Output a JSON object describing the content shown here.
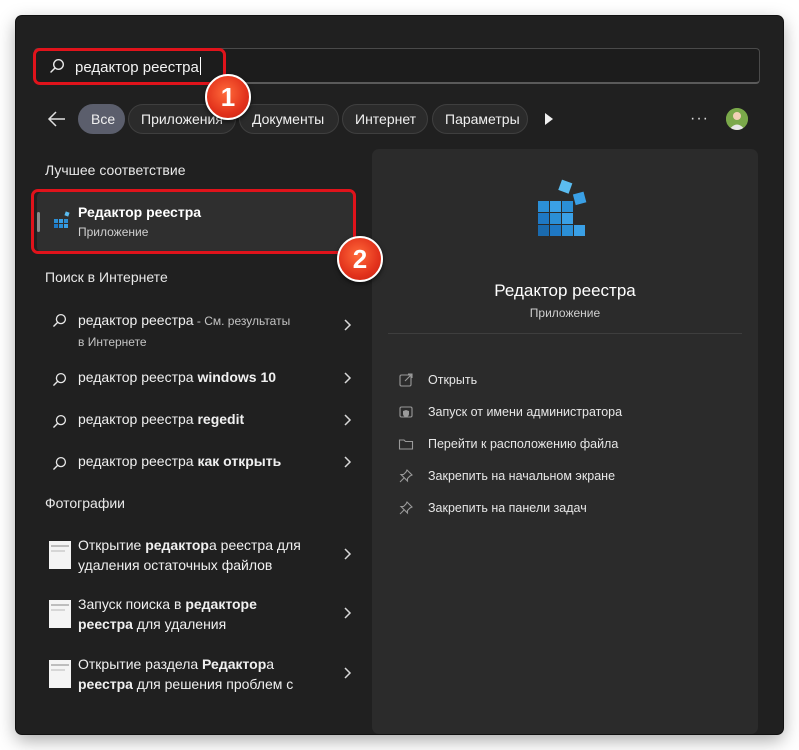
{
  "search": {
    "query": "редактор реестра"
  },
  "filters": {
    "chips": [
      "Все",
      "Приложения",
      "Документы",
      "Интернет",
      "Параметры"
    ],
    "more_label": "···"
  },
  "best_match": {
    "heading": "Лучшее соответствие",
    "title": "Редактор реестра",
    "subtitle": "Приложение"
  },
  "web": {
    "heading": "Поиск в Интернете",
    "items": [
      {
        "prefix": "редактор реестра",
        "bold": "",
        "suffix": " - См. результаты",
        "suffix2": "в Интернете"
      },
      {
        "prefix": "редактор реестра ",
        "bold": "windows 10",
        "suffix": "",
        "suffix2": ""
      },
      {
        "prefix": "редактор реестра ",
        "bold": "regedit",
        "suffix": "",
        "suffix2": ""
      },
      {
        "prefix": "редактор реестра ",
        "bold": "как открыть",
        "suffix": "",
        "suffix2": ""
      }
    ]
  },
  "photos": {
    "heading": "Фотографии",
    "items": [
      {
        "l1a": "Открытие ",
        "l1b": "редактор",
        "l1c": "а реестра для",
        "l2a": "",
        "l2b": "",
        "l2c": "удаления остаточных файлов"
      },
      {
        "l1a": "Запуск поиска в ",
        "l1b": "редакторе",
        "l1c": "",
        "l2a": "",
        "l2b": "реестра",
        "l2c": " для удаления"
      },
      {
        "l1a": "Открытие раздела ",
        "l1b": "Редактор",
        "l1c": "а",
        "l2a": "",
        "l2b": "реестра",
        "l2c": " для решения проблем с"
      }
    ]
  },
  "detail": {
    "title": "Редактор реестра",
    "subtitle": "Приложение",
    "actions": [
      {
        "label": "Открыть",
        "icon": "open-icon"
      },
      {
        "label": "Запуск от имени администратора",
        "icon": "shield-icon"
      },
      {
        "label": "Перейти к расположению файла",
        "icon": "folder-icon"
      },
      {
        "label": "Закрепить на начальном экране",
        "icon": "pin-icon"
      },
      {
        "label": "Закрепить на панели задач",
        "icon": "pin-icon"
      }
    ]
  },
  "annotations": {
    "badge1": "1",
    "badge2": "2",
    "highlight_color": "#e0131b"
  },
  "colors": {
    "background": "#202020",
    "panel": "#2b2b2b",
    "selected": "#2f2f2f",
    "active_chip": "#5b5e6c"
  }
}
